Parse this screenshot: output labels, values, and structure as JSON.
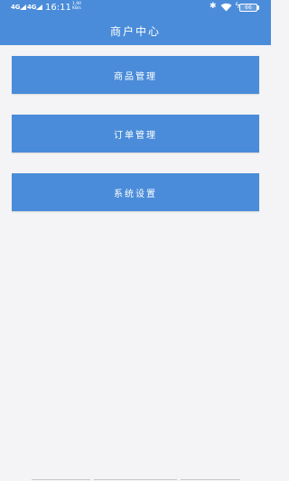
{
  "status_bar": {
    "signal_1": "4G",
    "signal_2": "4G",
    "time": "16:11",
    "net_speed_value": "1.90",
    "net_speed_unit": "KB/s",
    "battery_level": "66"
  },
  "header": {
    "title": "商户中心"
  },
  "menu": {
    "items": [
      {
        "label": "商品管理"
      },
      {
        "label": "订单管理"
      },
      {
        "label": "系统设置"
      }
    ]
  },
  "colors": {
    "primary": "#4a8cd9",
    "background": "#f4f3f6",
    "text_on_primary": "#ffffff"
  }
}
